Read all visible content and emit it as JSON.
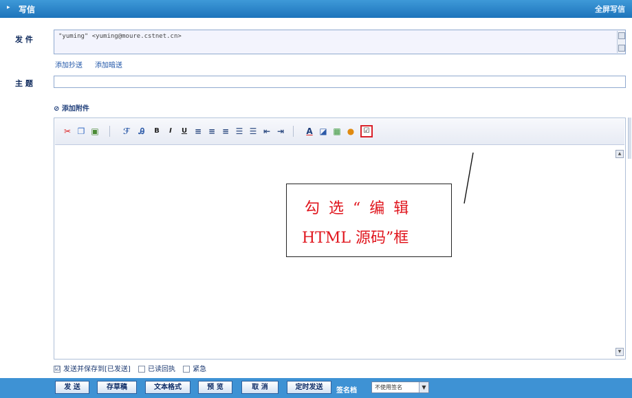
{
  "header": {
    "arrow": "▸",
    "title": "写信",
    "fullscreen_label": "全屏写信"
  },
  "from": {
    "label": "发 件",
    "value": "\"yuming\" <yuming@moure.cstnet.cn>"
  },
  "links": {
    "cc": "添加抄送",
    "bcc": "添加暗送"
  },
  "subject": {
    "label": "主 题",
    "value": ""
  },
  "attachment": {
    "label": "添加附件"
  },
  "toolbar": {
    "source_checkbox": "☑"
  },
  "callout": {
    "line1": "勾选“编辑",
    "line2": "HTML 源码”框"
  },
  "options": {
    "save_sent": "发送并保存到[已发送]",
    "save_sent_checked": "☑",
    "read_receipt": "已读回执",
    "urgent": "紧急"
  },
  "buttons": {
    "send": "发 送",
    "draft": "存草稿",
    "text_mode": "文本格式",
    "preview": "预 览",
    "cancel": "取 消",
    "timed_send": "定时发送"
  },
  "signature": {
    "label": "签名档",
    "selected": "不使用签名"
  },
  "colors": {
    "bar_blue": "#2a86cc",
    "callout_red": "#e0161e",
    "highlight_red": "#d91f28"
  }
}
